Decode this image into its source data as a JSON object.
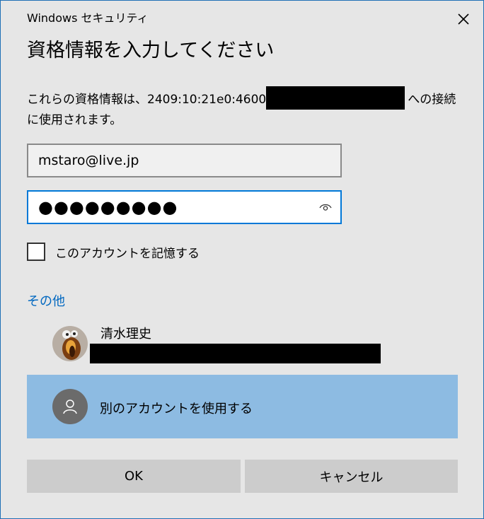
{
  "window": {
    "app_title": "Windows セキュリティ"
  },
  "dialog": {
    "heading": "資格情報を入力してください",
    "message_prefix": "これらの資格情報は、2409:10:21e0:4600",
    "message_suffix": "への接続に使用されます。"
  },
  "form": {
    "username_value": "mstaro@live.jp",
    "password_mask": "●●●●●●●●●",
    "remember_label": "このアカウントを記憶する",
    "remember_checked": false
  },
  "more": {
    "label": "その他"
  },
  "accounts": [
    {
      "name": "清水理史"
    },
    {
      "name": "別のアカウントを使用する"
    }
  ],
  "buttons": {
    "ok": "OK",
    "cancel": "キャンセル"
  },
  "colors": {
    "accent": "#0078d7",
    "link": "#0067c0",
    "selected_row": "#8dbbe2",
    "dialog_bg": "#e6e6e6",
    "button_bg": "#cccccc"
  }
}
